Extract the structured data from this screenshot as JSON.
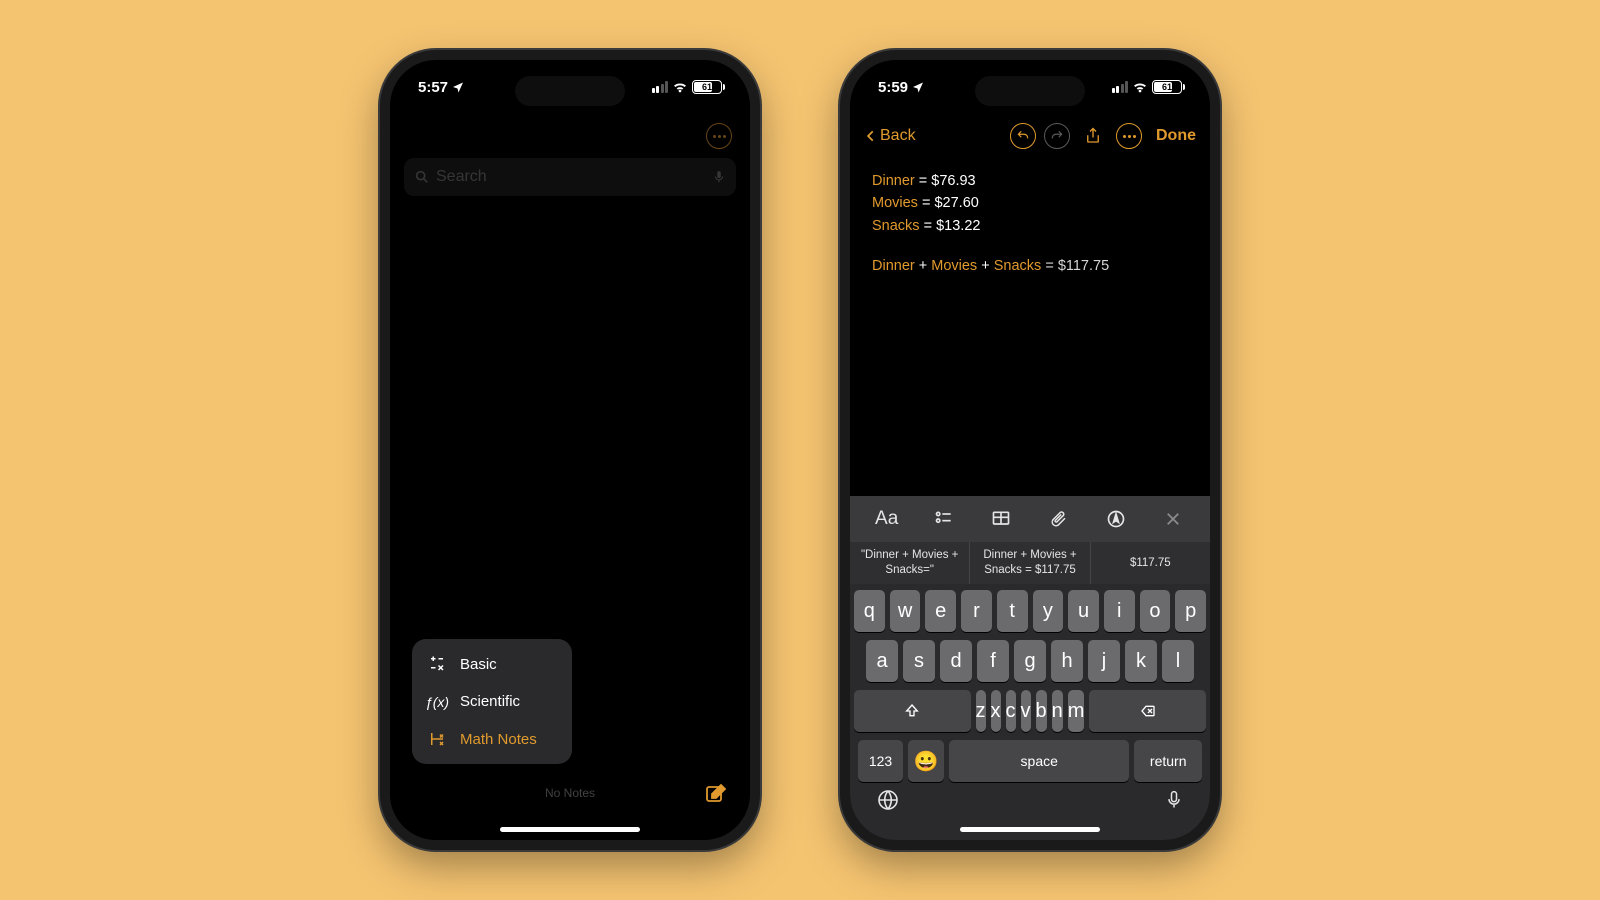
{
  "phone_a": {
    "status": {
      "time": "5:57",
      "battery": "61"
    },
    "search": {
      "placeholder": "Search"
    },
    "menu": {
      "basic": "Basic",
      "scientific": "Scientific",
      "math_notes": "Math Notes"
    },
    "no_notes": "No Notes"
  },
  "phone_b": {
    "status": {
      "time": "5:59",
      "battery": "61"
    },
    "nav": {
      "back": "Back",
      "done": "Done"
    },
    "note": {
      "lines": [
        {
          "var": "Dinner",
          "val": "$76.93"
        },
        {
          "var": "Movies",
          "val": "$27.60"
        },
        {
          "var": "Snacks",
          "val": "$13.22"
        }
      ],
      "sum_vars": [
        "Dinner",
        "Movies",
        "Snacks"
      ],
      "sum_result": "$117.75"
    },
    "keyboard": {
      "suggestions": [
        "\"Dinner + Movies + Snacks=\"",
        "Dinner + Movies + Snacks = $117.75",
        "$117.75"
      ],
      "rows": [
        [
          "q",
          "w",
          "e",
          "r",
          "t",
          "y",
          "u",
          "i",
          "o",
          "p"
        ],
        [
          "a",
          "s",
          "d",
          "f",
          "g",
          "h",
          "j",
          "k",
          "l"
        ],
        [
          "z",
          "x",
          "c",
          "v",
          "b",
          "n",
          "m"
        ]
      ],
      "numbers": "123",
      "space": "space",
      "return": "return"
    }
  }
}
